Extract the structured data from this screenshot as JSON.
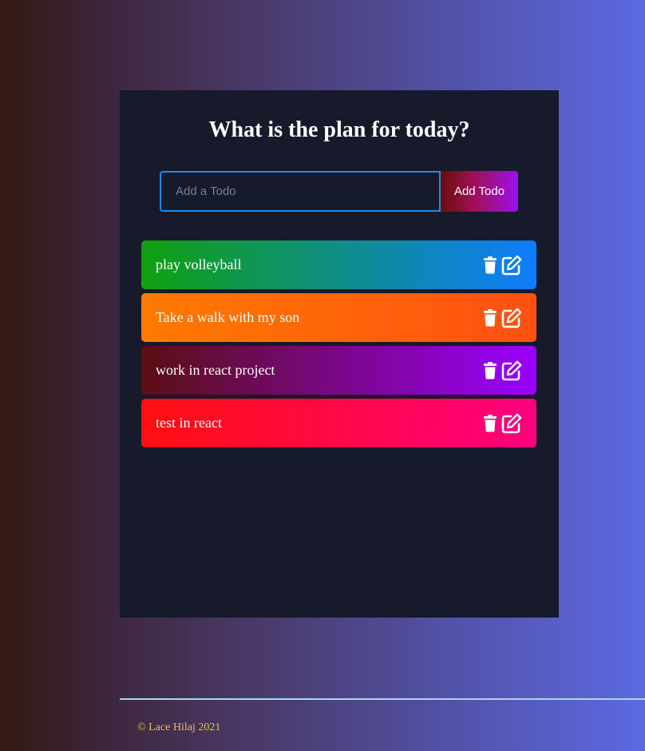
{
  "app": {
    "title": "What is the plan for today?"
  },
  "form": {
    "input_placeholder": "Add a Todo",
    "input_value": "",
    "add_button_label": "Add Todo"
  },
  "todos": [
    {
      "text": "play volleyball",
      "gradient": [
        "#10a010",
        "#0f7cff"
      ]
    },
    {
      "text": "Take a walk with my son",
      "gradient": [
        "#ff7a00",
        "#ff5012"
      ]
    },
    {
      "text": "work in react project",
      "gradient": [
        "#5a0f12",
        "#9a00ff"
      ]
    },
    {
      "text": "test in react",
      "gradient": [
        "#ff0f0f",
        "#ff0080"
      ]
    }
  ],
  "icons": {
    "delete": "trash-icon",
    "edit": "edit-icon"
  },
  "colors": {
    "panel_background": "#161a2b",
    "input_border": "#1e8ce8",
    "footer_line": "#a8d8ef",
    "footer_text": "#e2c24a"
  },
  "footer": {
    "copyright": "© Lace Hilaj 2021"
  }
}
